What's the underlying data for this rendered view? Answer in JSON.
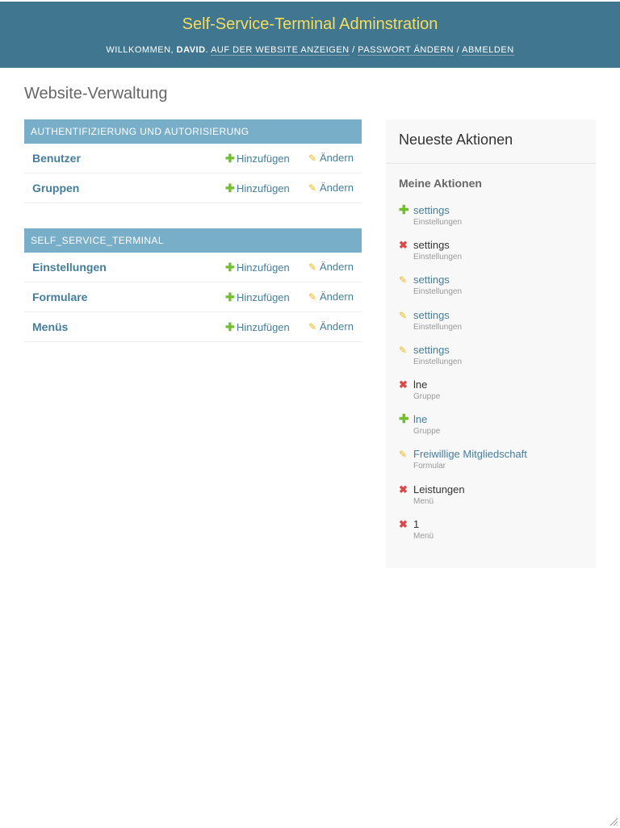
{
  "header": {
    "site_name": "Self-Service-Terminal Adminstration",
    "welcome": "Willkommen,",
    "username": "David",
    "view_site": "Auf der Website anzeigen",
    "change_password": "Passwort ändern",
    "logout": "Abmelden",
    "separator": "/"
  },
  "page_title": "Website-Verwaltung",
  "modules": [
    {
      "caption": "Authentifizierung und Autorisierung",
      "models": [
        {
          "name": "Benutzer",
          "add": "Hinzufügen",
          "change": "Ändern"
        },
        {
          "name": "Gruppen",
          "add": "Hinzufügen",
          "change": "Ändern"
        }
      ]
    },
    {
      "caption": "self_service_terminal",
      "models": [
        {
          "name": "Einstellungen",
          "add": "Hinzufügen",
          "change": "Ändern"
        },
        {
          "name": "Formulare",
          "add": "Hinzufügen",
          "change": "Ändern"
        },
        {
          "name": "Menüs",
          "add": "Hinzufügen",
          "change": "Ändern"
        }
      ]
    }
  ],
  "recent_actions": {
    "title": "Neueste Aktionen",
    "subtitle": "Meine Aktionen",
    "items": [
      {
        "action": "add",
        "icon": "plus-icon",
        "object": "settings",
        "type": "Einstellungen",
        "linked": true
      },
      {
        "action": "delete",
        "icon": "x-icon",
        "object": "settings",
        "type": "Einstellungen",
        "linked": false
      },
      {
        "action": "change",
        "icon": "pencil-icon",
        "object": "settings",
        "type": "Einstellungen",
        "linked": true
      },
      {
        "action": "change",
        "icon": "pencil-icon",
        "object": "settings",
        "type": "Einstellungen",
        "linked": true
      },
      {
        "action": "change",
        "icon": "pencil-icon",
        "object": "settings",
        "type": "Einstellungen",
        "linked": true
      },
      {
        "action": "delete",
        "icon": "x-icon",
        "object": "lne",
        "type": "Gruppe",
        "linked": false
      },
      {
        "action": "add",
        "icon": "plus-icon",
        "object": "lne",
        "type": "Gruppe",
        "linked": true
      },
      {
        "action": "change",
        "icon": "pencil-icon",
        "object": "Freiwillige Mitgliedschaft",
        "type": "Formular",
        "linked": true
      },
      {
        "action": "delete",
        "icon": "x-icon",
        "object": "Leistungen",
        "type": "Menü",
        "linked": false
      },
      {
        "action": "delete",
        "icon": "x-icon",
        "object": "1",
        "type": "Menü",
        "linked": false
      }
    ]
  },
  "colors": {
    "header_bg": "#417690",
    "site_name": "#f5dd5d",
    "module_caption_bg": "#79aec8",
    "link": "#447e9b",
    "add_icon": "#70bf2b",
    "change_icon": "#efb80b",
    "delete_icon": "#dd4646",
    "sidebar_bg": "#f8f8f8"
  }
}
